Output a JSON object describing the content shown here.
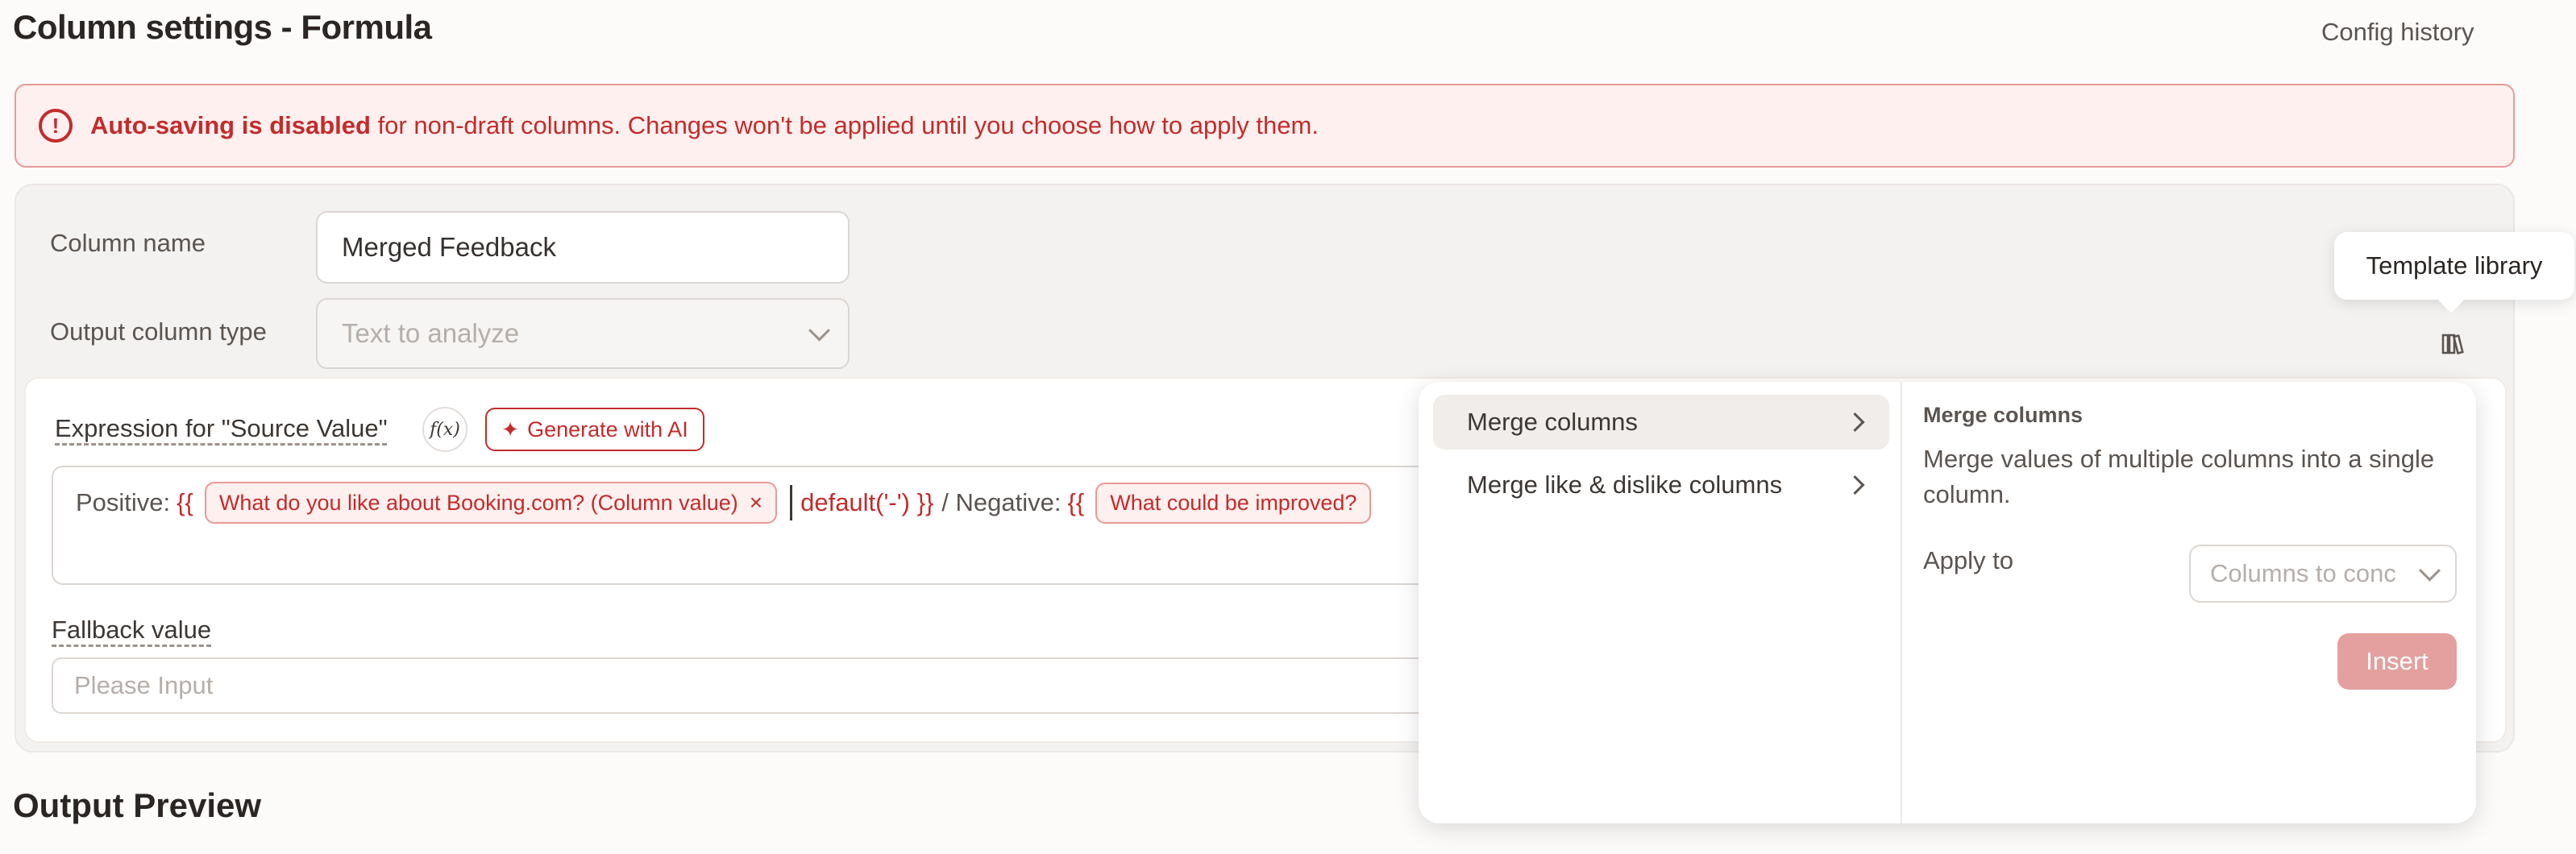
{
  "header": {
    "title": "Column settings - Formula",
    "config_history": "Config history"
  },
  "alert": {
    "icon": "exclamation-circle-icon",
    "bold_text": "Auto-saving is disabled",
    "text": " for non-draft columns. Changes won't be applied until you choose how to apply them."
  },
  "form": {
    "column_name_label": "Column name",
    "column_name_value": "Merged Feedback",
    "output_type_label": "Output column type",
    "output_type_value": "Text to analyze"
  },
  "template_library": {
    "tooltip": "Template library",
    "icon": "books-icon"
  },
  "expression": {
    "label": "Expression for \"Source Value\"",
    "fx_label": "f(x)",
    "generate_ai": "Generate with AI",
    "positive_prefix": "Positive:",
    "open_brace": "{{",
    "token1": "What do you like about Booking.com? (Column value)",
    "token_close": "×",
    "filter": "default('-') }}",
    "negative_prefix": "/ Negative:",
    "open_brace2": "{{",
    "token2": "What could be improved?"
  },
  "fallback": {
    "label": "Fallback value",
    "placeholder": "Please Input"
  },
  "output_preview": "Output Preview",
  "popover": {
    "menu": [
      {
        "label": "Merge columns",
        "active": true
      },
      {
        "label": "Merge like & dislike columns",
        "active": false
      }
    ],
    "detail_title": "Merge columns",
    "detail_description": "Merge values of multiple columns into a single column.",
    "apply_to_label": "Apply to",
    "apply_to_placeholder": "Columns to conc",
    "insert_label": "Insert"
  },
  "colors": {
    "accent": "#c42b2b",
    "alert_bg": "#fdf0ef",
    "insert_bg": "#e3a09e"
  }
}
